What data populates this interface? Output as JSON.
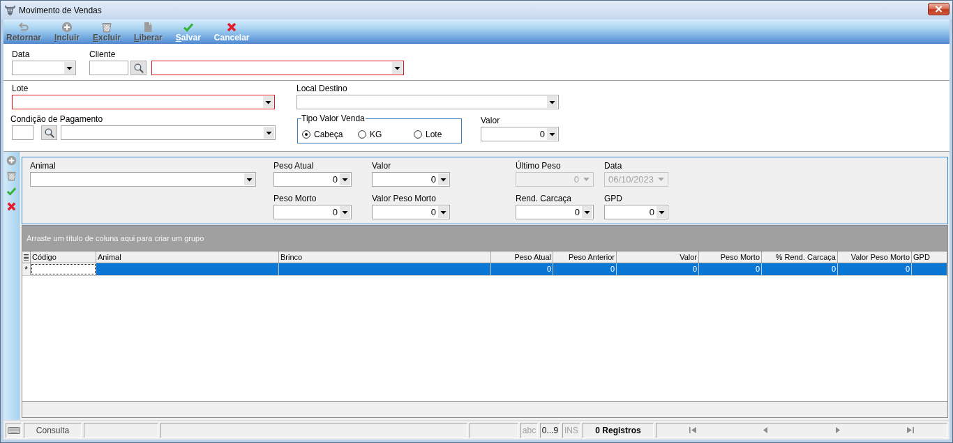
{
  "window": {
    "title": "Movimento de Vendas"
  },
  "toolbar": [
    {
      "kind": "return",
      "label": "Retornar",
      "disabled": true,
      "mnemonic": false
    },
    {
      "kind": "add",
      "label": "Incluir",
      "disabled": true,
      "mnemonic": true
    },
    {
      "kind": "delete",
      "label": "Excluir",
      "disabled": true,
      "mnemonic": true
    },
    {
      "kind": "release",
      "label": "Liberar",
      "disabled": true,
      "mnemonic": true
    },
    {
      "kind": "save",
      "label": "Salvar",
      "disabled": false,
      "mnemonic": true
    },
    {
      "kind": "cancel",
      "label": "Cancelar",
      "disabled": false,
      "mnemonic": false
    }
  ],
  "header": {
    "data": {
      "label": "Data",
      "required": false
    },
    "cliente": {
      "label": "Cliente",
      "required": true
    }
  },
  "form": {
    "lote": {
      "label": "Lote",
      "required": true
    },
    "local_destino": {
      "label": "Local Destino",
      "required": false
    },
    "condicao_pagamento": {
      "label": "Condição de Pagamento",
      "required": false
    },
    "tipo_valor_venda": {
      "label": "Tipo Valor Venda",
      "options": [
        {
          "label": "Cabeça",
          "selected": true
        },
        {
          "label": "KG",
          "selected": false
        },
        {
          "label": "Lote",
          "selected": false
        }
      ]
    },
    "valor": {
      "label": "Valor",
      "value": "0"
    }
  },
  "side_actions": [
    {
      "kind": "add",
      "disabled": true
    },
    {
      "kind": "delete",
      "disabled": true
    },
    {
      "kind": "confirm",
      "disabled": false
    },
    {
      "kind": "cancel",
      "disabled": false
    }
  ],
  "animal_panel": {
    "rows": [
      [
        {
          "label": "Animal",
          "disabled": false
        },
        {
          "label": "Peso Atual",
          "value": "0",
          "disabled": false
        },
        {
          "label": "Valor",
          "value": "0",
          "disabled": false
        },
        {
          "label": "Último Peso",
          "value": "0",
          "disabled": true
        },
        {
          "label": "Data",
          "value": "06/10/2023",
          "disabled": true
        }
      ],
      [
        null,
        {
          "label": "Peso Morto",
          "value": "0",
          "disabled": false
        },
        {
          "label": "Valor Peso Morto",
          "value": "0",
          "disabled": false
        },
        {
          "label": "Rend. Carcaça",
          "value": "0",
          "disabled": false
        },
        {
          "label": "GPD",
          "value": "0",
          "disabled": false
        }
      ]
    ]
  },
  "grid": {
    "group_hint": "Arraste um título de coluna aqui para criar um grupo",
    "columns": [
      {
        "label": "Código",
        "numeric": false
      },
      {
        "label": "Animal",
        "numeric": false
      },
      {
        "label": "Brinco",
        "numeric": false
      },
      {
        "label": "Peso Atual",
        "numeric": true
      },
      {
        "label": "Peso Anterior",
        "numeric": true
      },
      {
        "label": "Valor",
        "numeric": true
      },
      {
        "label": "Peso Morto",
        "numeric": true
      },
      {
        "label": "% Rend. Carcaça",
        "numeric": true
      },
      {
        "label": "Valor Peso Morto",
        "numeric": true
      },
      {
        "label": "GPD",
        "numeric": false
      }
    ],
    "rows": [
      {
        "marker": "*",
        "selected": true,
        "cells": [
          {
            "focused": true
          },
          {
            "focused": false
          },
          {
            "focused": false
          },
          {
            "text": "0",
            "focused": false
          },
          {
            "text": "0",
            "focused": false
          },
          {
            "text": "0",
            "focused": false
          },
          {
            "text": "0",
            "focused": false
          },
          {
            "text": "0",
            "focused": false
          },
          {
            "text": "0",
            "focused": false
          },
          {
            "focused": false
          }
        ]
      }
    ]
  },
  "status_bar": {
    "mode": "Consulta",
    "indicators": [
      {
        "label": "abc",
        "active": false
      },
      {
        "label": "0...9",
        "active": true
      },
      {
        "label": "INS",
        "active": false
      }
    ],
    "records": "0 Registros",
    "navigation": [
      {
        "kind": "first",
        "disabled": true
      },
      {
        "kind": "previous",
        "disabled": true
      },
      {
        "kind": "next",
        "disabled": true
      },
      {
        "kind": "last",
        "disabled": true
      }
    ]
  }
}
